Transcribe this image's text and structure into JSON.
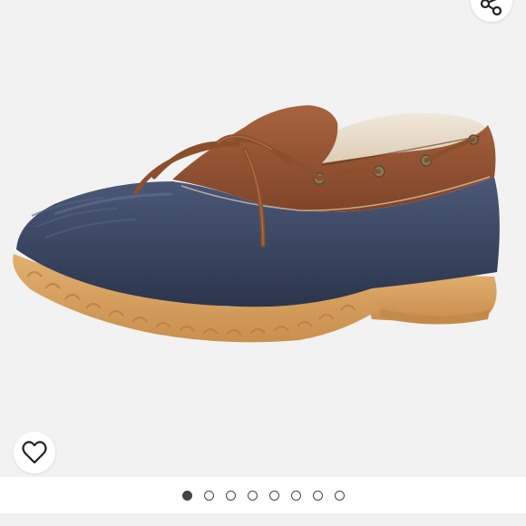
{
  "listing": {
    "photo": {
      "subject": "duck-boot-shoe-image"
    },
    "actions": {
      "share_icon": "share-icon",
      "like_icon": "heart-icon"
    },
    "carousel": {
      "total_images": 8,
      "active_index": 0
    }
  },
  "colors": {
    "photo_background": "#f2f2f2",
    "shoe_navy": "#3a4660",
    "shoe_tan_leather": "#8e4f31",
    "sole_gum": "#d9a464",
    "lining_sherpa": "#e8dccb",
    "dot": "#444444"
  }
}
